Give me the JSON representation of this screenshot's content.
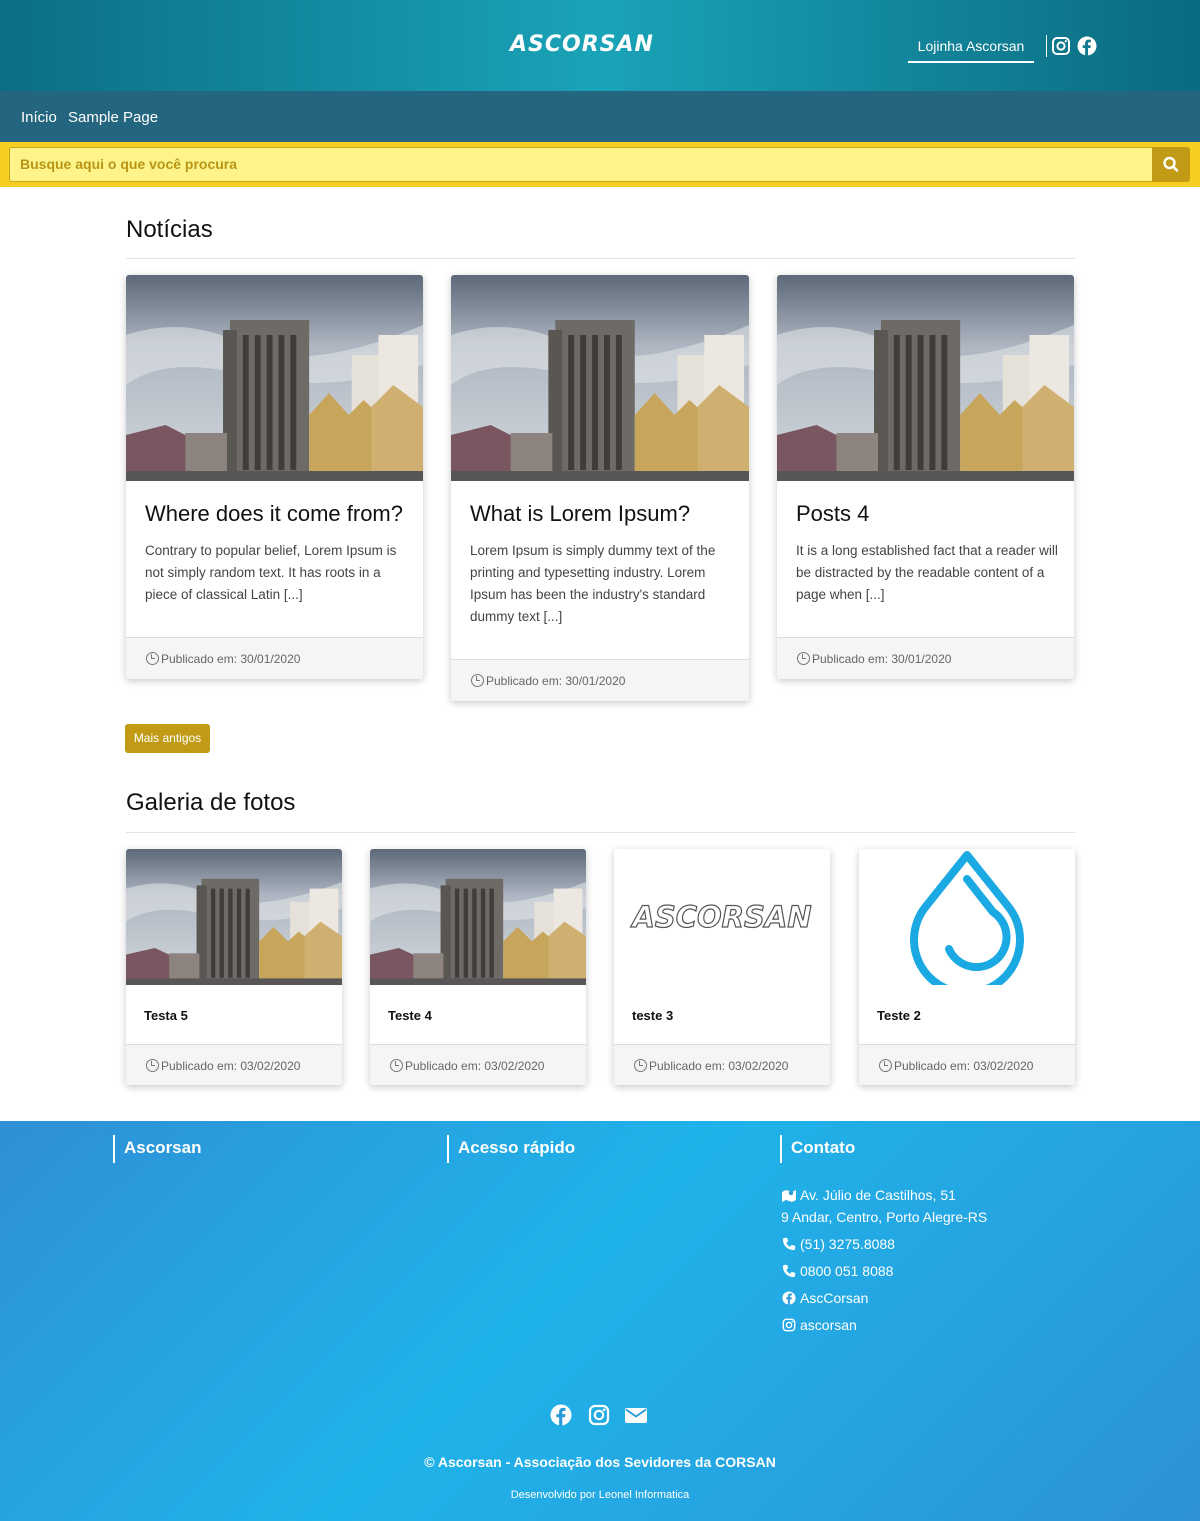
{
  "header": {
    "logo": "ASCORSAN",
    "shop_link": "Lojinha Ascorsan",
    "social": [
      "instagram-icon",
      "facebook-icon"
    ]
  },
  "nav": {
    "items": [
      {
        "label": "Início"
      },
      {
        "label": "Sample Page"
      }
    ]
  },
  "search": {
    "placeholder": "Busque aqui o que você procura"
  },
  "news": {
    "title": "Notícias",
    "cards": [
      {
        "title": "Where does it come from?",
        "excerpt": "Contrary to popular belief, Lorem Ipsum is not simply random text. It has roots in a piece of classical Latin [...]",
        "date": "Publicado em: 30/01/2020"
      },
      {
        "title": "What is Lorem Ipsum?",
        "excerpt": "Lorem Ipsum is simply dummy text of the printing and typesetting industry. Lorem Ipsum has been the industry's standard dummy text [...]",
        "date": "Publicado em: 30/01/2020"
      },
      {
        "title": "Posts 4",
        "excerpt": "It is a long established fact that a reader will be distracted by the readable content of a page when [...]",
        "date": "Publicado em: 30/01/2020"
      }
    ],
    "older_button": "Mais antigos"
  },
  "gallery": {
    "title": "Galeria de fotos",
    "items": [
      {
        "title": "Testa 5",
        "date": "Publicado em: 03/02/2020"
      },
      {
        "title": "Teste 4",
        "date": "Publicado em: 03/02/2020"
      },
      {
        "title": "teste 3",
        "date": "Publicado em: 03/02/2020"
      },
      {
        "title": "Teste 2",
        "date": "Publicado em: 03/02/2020"
      }
    ]
  },
  "footer": {
    "col1": "Ascorsan",
    "col2": "Acesso rápido",
    "col3": "Contato",
    "address1": "Av. Júlio de Castilhos, 51",
    "address2": "9 Andar, Centro, Porto Alegre-RS",
    "phone1": "(51) 3275.8088",
    "phone2": "0800 051 8088",
    "facebook": "AscCorsan",
    "instagram": "ascorsan",
    "copyright": "© Ascorsan - Associação dos Sevidores da CORSAN",
    "developed_by": "Desenvolvido por Leonel Informatica"
  },
  "colors": {
    "header": "#1a95ab",
    "nav": "#24657f",
    "search_bar": "#f6cd21",
    "accent": "#c19b15",
    "footer": "#1fb3ea"
  }
}
